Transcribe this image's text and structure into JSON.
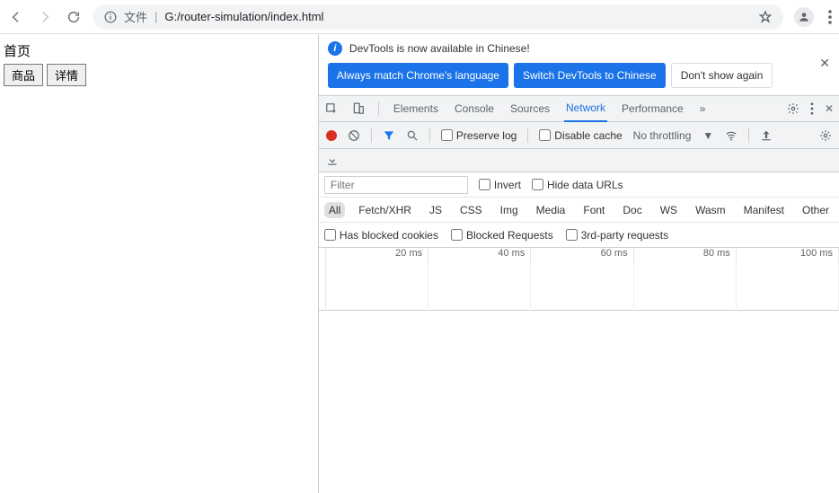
{
  "browser": {
    "url_prefix": "文件",
    "url": "G:/router-simulation/index.html"
  },
  "page": {
    "title": "首页",
    "btn1": "商品",
    "btn2": "详情"
  },
  "banner": {
    "text": "DevTools is now available in Chinese!",
    "btn1": "Always match Chrome's language",
    "btn2": "Switch DevTools to Chinese",
    "btn3": "Don't show again"
  },
  "tabs": {
    "elements": "Elements",
    "console": "Console",
    "sources": "Sources",
    "network": "Network",
    "performance": "Performance"
  },
  "toolbar": {
    "preserve": "Preserve log",
    "disable": "Disable cache",
    "throttle": "No throttling"
  },
  "filter": {
    "placeholder": "Filter",
    "invert": "Invert",
    "hide": "Hide data URLs"
  },
  "types": {
    "all": "All",
    "fetch": "Fetch/XHR",
    "js": "JS",
    "css": "CSS",
    "img": "Img",
    "media": "Media",
    "font": "Font",
    "doc": "Doc",
    "ws": "WS",
    "wasm": "Wasm",
    "manifest": "Manifest",
    "other": "Other"
  },
  "checks": {
    "blocked_cookies": "Has blocked cookies",
    "blocked_req": "Blocked Requests",
    "third": "3rd-party requests"
  },
  "timeline": [
    "20 ms",
    "40 ms",
    "60 ms",
    "80 ms",
    "100 ms"
  ]
}
